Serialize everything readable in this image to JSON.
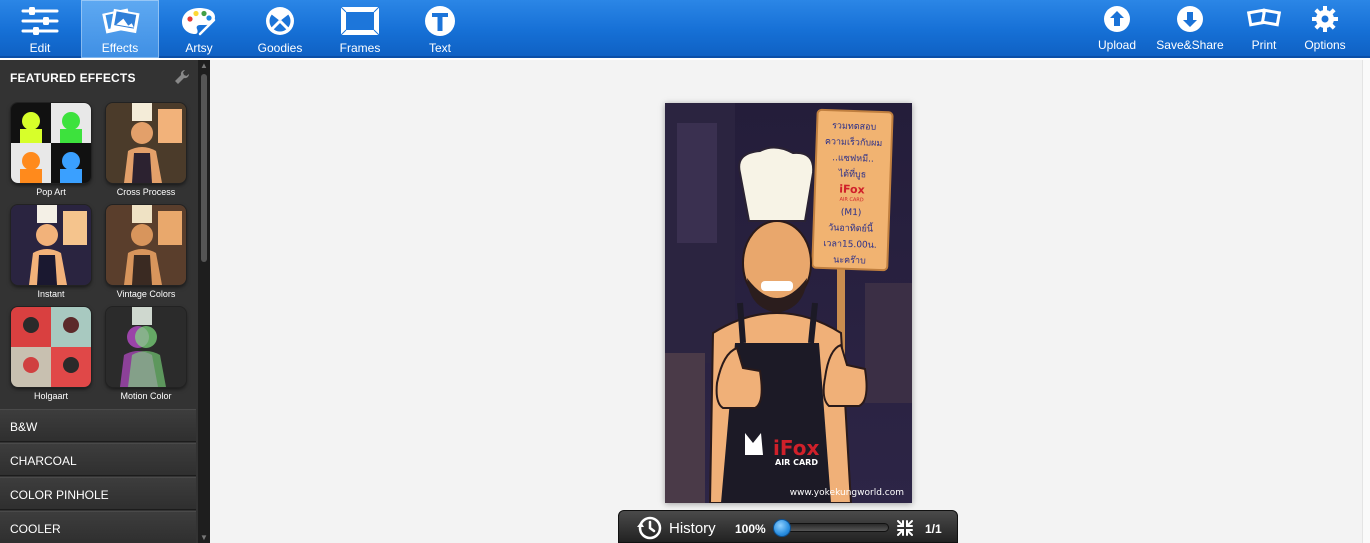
{
  "toolbar": {
    "left_tools": [
      {
        "label": "Edit",
        "icon": "sliders-icon"
      },
      {
        "label": "Effects",
        "icon": "photos-icon",
        "active": true
      },
      {
        "label": "Artsy",
        "icon": "palette-icon"
      },
      {
        "label": "Goodies",
        "icon": "goodies-icon"
      },
      {
        "label": "Frames",
        "icon": "frame-icon"
      },
      {
        "label": "Text",
        "icon": "text-icon"
      }
    ],
    "right_tools": [
      {
        "label": "Upload",
        "icon": "upload-icon"
      },
      {
        "label": "Save&Share",
        "icon": "download-icon"
      },
      {
        "label": "Print",
        "icon": "print-icon"
      },
      {
        "label": "Options",
        "icon": "gear-icon"
      }
    ],
    "accent": "#1670d6"
  },
  "sidebar": {
    "featured_title": "FEATURED EFFECTS",
    "effects": [
      {
        "label": "Pop Art"
      },
      {
        "label": "Cross Process"
      },
      {
        "label": "Instant"
      },
      {
        "label": "Vintage Colors"
      },
      {
        "label": "Holgaart"
      },
      {
        "label": "Motion Color"
      }
    ],
    "categories": [
      "B&W",
      "CHARCOAL",
      "COLOR PINHOLE",
      "COOLER"
    ]
  },
  "photo": {
    "sign_lines": [
      "รวมทดสอบ",
      "ความเร็วกับผม",
      "..แซฟหมี..",
      "ได้ที่บูธ",
      "iFox",
      "AIR CARD",
      "(M1)",
      "วันอาทิตย์นี้",
      "เวลา15.00น.",
      "นะคร๊าบ"
    ],
    "apron_brand": "iFox",
    "apron_sub": "AIR CARD",
    "watermark": "www.yokekungworld.com"
  },
  "bottombar": {
    "history_label": "History",
    "zoom": "100%",
    "zoom_fraction": 0.0,
    "page": "1/1"
  }
}
